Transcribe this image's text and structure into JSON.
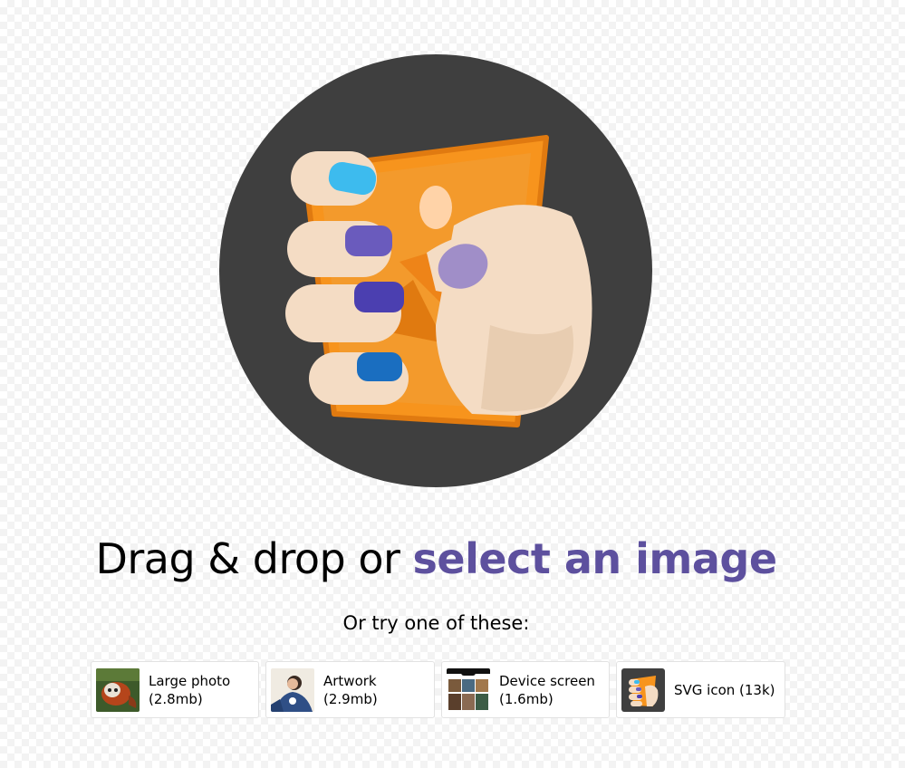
{
  "app": {
    "logo_name": "hand-holding-orange-card-logo",
    "accent_color": "#5d509e",
    "logo_bg_color": "#3f3f3f"
  },
  "dropzone": {
    "prefix_text": "Drag & drop or",
    "link_text": "select an image",
    "subtitle": "Or try one of these:"
  },
  "samples": [
    {
      "title": "Large photo",
      "size": "(2.8mb)",
      "thumb_icon": "red-panda-photo-thumb"
    },
    {
      "title": "Artwork",
      "size": "(2.9mb)",
      "thumb_icon": "artwork-portrait-thumb"
    },
    {
      "title": "Device screen",
      "size": "(1.6mb)",
      "thumb_icon": "phone-screenshot-thumb"
    },
    {
      "title": "SVG icon (13k)",
      "size": "",
      "thumb_icon": "svg-logo-thumb"
    }
  ]
}
